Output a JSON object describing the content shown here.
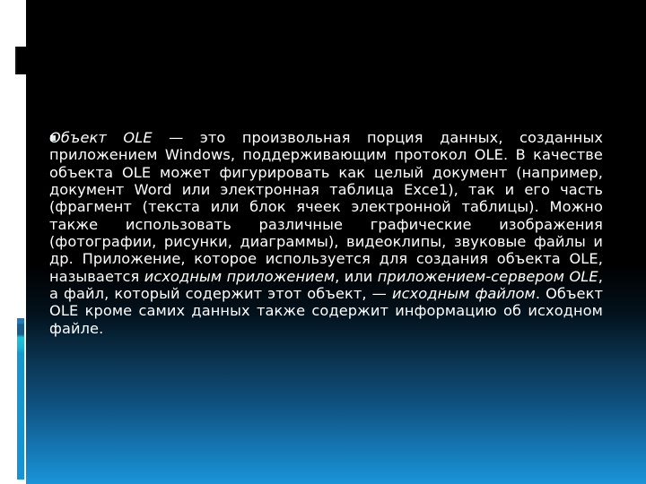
{
  "slide": {
    "bullet_icon": "square-bullet",
    "paragraph": {
      "intro_italic": "Объект OLE",
      "part1": " — это произвольная порция данных, созданных приложением Windows, поддерживающим протокол OLE. В качестве объекта OLE может фигурировать как целый документ (например, документ Word или электронная таблица Exce1), так и его часть (фрагмент (текста или блок ячеек электронной таблицы). Можно также использовать различные графические изображения (фотографии, рисунки, диаграммы), видеоклипы, звуковые файлы и др. Приложение, которое используется для создания объекта OLE, называется ",
      "term1_italic": "исходным приложением",
      "part2": ", или ",
      "term2_italic": "приложением-сервером OLE",
      "part3": ", а файл, который содержит этот объект, — ",
      "term3_italic": "исходным файлом",
      "part4": ". Объект OLE кроме самих данных также содержит информацию об исходном файле."
    }
  },
  "colors": {
    "text": "#ffffff",
    "background_top": "#000000",
    "background_bottom": "#1a95d8",
    "accent_blue": "#1593d6"
  }
}
